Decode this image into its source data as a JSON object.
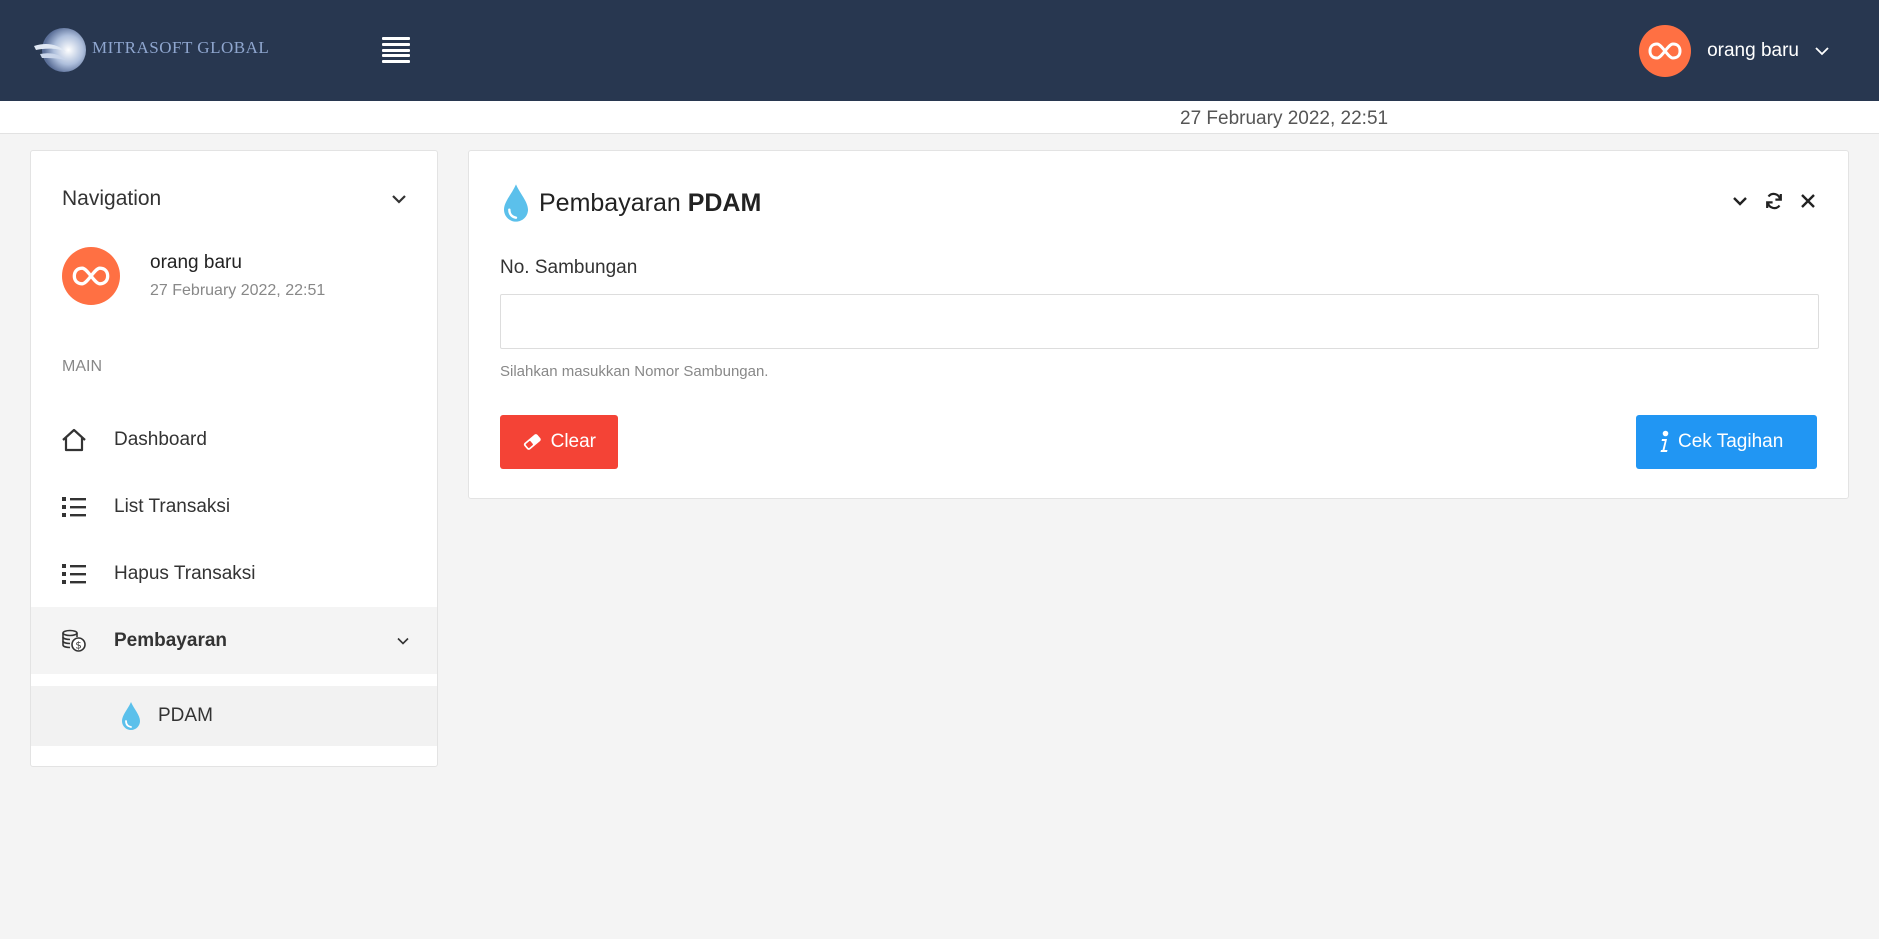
{
  "brand": {
    "name": "MITRASOFT GLOBAL"
  },
  "header": {
    "user_name": "orang baru",
    "datetime": "27 February 2022, 22:51"
  },
  "sidebar": {
    "title": "Navigation",
    "user": {
      "name": "orang baru",
      "datetime": "27 February 2022, 22:51"
    },
    "section_label": "MAIN",
    "items": [
      {
        "label": "Dashboard",
        "icon": "home-icon"
      },
      {
        "label": "List Transaksi",
        "icon": "list-icon"
      },
      {
        "label": "Hapus Transaksi",
        "icon": "list-icon"
      },
      {
        "label": "Pembayaran",
        "icon": "coins-icon",
        "expanded": true
      }
    ],
    "subitems": [
      {
        "label": "PDAM",
        "icon": "water-drop-icon",
        "active": true
      }
    ]
  },
  "panel": {
    "title_prefix": "Pembayaran",
    "title_bold": "PDAM",
    "field_label": "No. Sambungan",
    "field_value": "",
    "field_placeholder": "",
    "help_text": "Silahkan masukkan Nomor Sambungan.",
    "clear_label": "Clear",
    "submit_label": "Cek Tagihan"
  },
  "colors": {
    "topbar": "#283750",
    "avatar": "#ff7043",
    "clear_button": "#f44336",
    "submit_button": "#2196f3",
    "water_drop": "#5bc0eb"
  }
}
